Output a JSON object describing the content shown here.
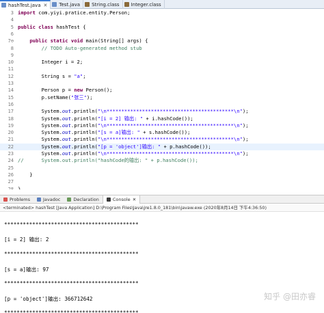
{
  "tabs": [
    {
      "label": "hashTest.java",
      "close": "✕",
      "color": "#6a8fc8"
    },
    {
      "label": "Test.java",
      "close": "",
      "color": "#6a8fc8"
    },
    {
      "label": "String.class",
      "close": "",
      "color": "#8a6a3a"
    },
    {
      "label": "Integer.class",
      "close": "",
      "color": "#8a6a3a"
    }
  ],
  "editor": {
    "lines": [
      {
        "n": "3",
        "html": "<span class=\"kw\">import</span> com.yiyi.pratice.entity.Person;"
      },
      {
        "n": "4",
        "html": ""
      },
      {
        "n": "5",
        "html": "<span class=\"kw\">public class</span> hashTest {"
      },
      {
        "n": "6",
        "html": ""
      },
      {
        "n": "7⊖",
        "html": "    <span class=\"kw\">public static void</span> main(String[] args) {"
      },
      {
        "n": "8",
        "html": "        <span class=\"cm\">// TODO Auto-generated method stub</span>"
      },
      {
        "n": "9",
        "html": ""
      },
      {
        "n": "10",
        "html": "        Integer i = 2;"
      },
      {
        "n": "11",
        "html": ""
      },
      {
        "n": "12",
        "html": "        String s = <span class=\"str\">\"a\"</span>;"
      },
      {
        "n": "13",
        "html": ""
      },
      {
        "n": "14",
        "html": "        Person p = <span class=\"kw\">new</span> Person();"
      },
      {
        "n": "15",
        "html": "        p.setName(<span class=\"str\">\"张三\"</span>);"
      },
      {
        "n": "16",
        "html": ""
      },
      {
        "n": "17",
        "html": "        System.<span class=\"fld\">out</span>.println(<span class=\"str\">\"\\n*******************************************\\n\"</span>);"
      },
      {
        "n": "18",
        "html": "        System.<span class=\"fld\">out</span>.println(<span class=\"str\">\"[i = 2] 输出: \"</span> + i.hashCode());"
      },
      {
        "n": "19",
        "html": "        System.<span class=\"fld\">out</span>.println(<span class=\"str\">\"\\n*******************************************\\n\"</span>);"
      },
      {
        "n": "20",
        "html": "        System.<span class=\"fld\">out</span>.println(<span class=\"str\">\"[s = a]输出: \"</span> + s.hashCode());"
      },
      {
        "n": "21",
        "html": "        System.<span class=\"fld\">out</span>.println(<span class=\"str\">\"\\n*******************************************\\n\"</span>);"
      },
      {
        "n": "22",
        "html": "        System.<span class=\"fld\">out</span>.println(<span class=\"str\">\"[p = 'object']输出: \"</span> + p.hashCode());",
        "hl": true
      },
      {
        "n": "23",
        "html": "        System.<span class=\"fld\">out</span>.println(<span class=\"str\">\"\\n*******************************************\\n\"</span>);"
      },
      {
        "n": "24",
        "html": "<span class=\"cm\">//      System.out.println(\"hashCode的输出: \" + p.hashCode());</span>"
      },
      {
        "n": "25",
        "html": ""
      },
      {
        "n": "26",
        "html": "    }"
      },
      {
        "n": "27",
        "html": ""
      },
      {
        "n": "28",
        "html": "}"
      },
      {
        "n": "29",
        "html": ""
      }
    ]
  },
  "views": [
    {
      "label": "Problems",
      "color": "#d9534f",
      "active": false
    },
    {
      "label": "Javadoc",
      "color": "#5a7fbf",
      "active": false
    },
    {
      "label": "Declaration",
      "color": "#6a9a5a",
      "active": false
    },
    {
      "label": "Console",
      "color": "#3a3a3a",
      "active": true,
      "close": "✕"
    }
  ],
  "terminated": "<terminated> hashTest [Java Application] D:\\Program Files\\Java\\jre1.8.0_181\\bin\\javaw.exe (2020年8月14日 下午4:36:50)",
  "console": [
    "",
    "*******************************************",
    "",
    "[i = 2] 输出: 2",
    "",
    "*******************************************",
    "",
    "[s = a]输出: 97",
    "",
    "*******************************************",
    "",
    "[p = 'object']输出: 366712642",
    "",
    "*******************************************"
  ],
  "watermark": "知乎 @田亦睿"
}
